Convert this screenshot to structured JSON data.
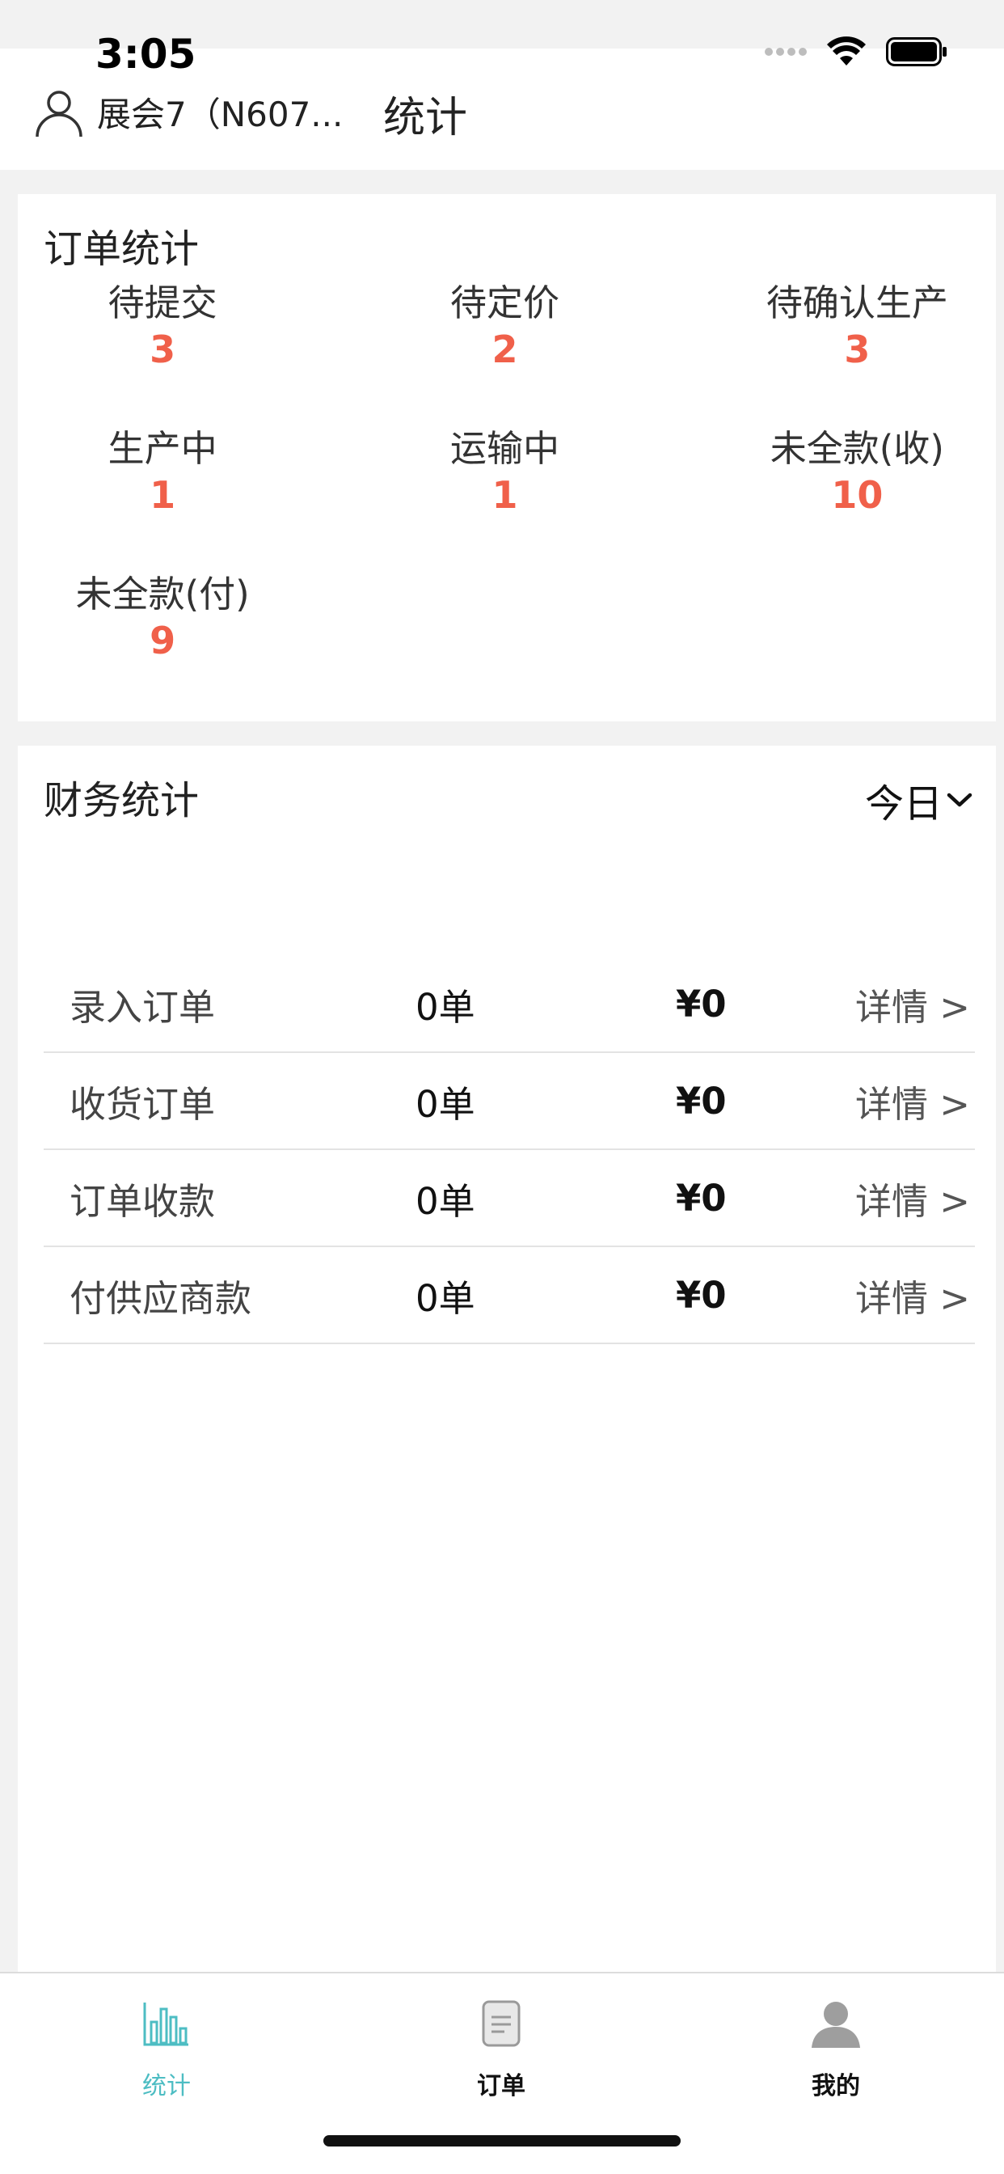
{
  "status_bar": {
    "time": "3:05"
  },
  "header": {
    "user_name": "展会7（N607...",
    "title": "统计"
  },
  "order_stats": {
    "title": "订单统计",
    "items": [
      {
        "label": "待提交",
        "count": "3"
      },
      {
        "label": "待定价",
        "count": "2"
      },
      {
        "label": "待确认生产",
        "count": "3"
      },
      {
        "label": "生产中",
        "count": "1"
      },
      {
        "label": "运输中",
        "count": "1"
      },
      {
        "label": "未全款(收)",
        "count": "10"
      },
      {
        "label": "未全款(付)",
        "count": "9"
      }
    ]
  },
  "finance_stats": {
    "title": "财务统计",
    "period": "今日",
    "rows": [
      {
        "name": "录入订单",
        "count": "0单",
        "amount": "¥0",
        "detail": "详情 >"
      },
      {
        "name": "收货订单",
        "count": "0单",
        "amount": "¥0",
        "detail": "详情 >"
      },
      {
        "name": "订单收款",
        "count": "0单",
        "amount": "¥0",
        "detail": "详情 >"
      },
      {
        "name": "付供应商款",
        "count": "0单",
        "amount": "¥0",
        "detail": "详情 >"
      }
    ]
  },
  "tab_bar": {
    "tabs": [
      {
        "label": "统计",
        "icon": "bar-chart-icon"
      },
      {
        "label": "订单",
        "icon": "document-icon"
      },
      {
        "label": "我的",
        "icon": "person-icon"
      }
    ]
  },
  "colors": {
    "accent": "#4dbdc3",
    "count_red": "#f0604a"
  }
}
